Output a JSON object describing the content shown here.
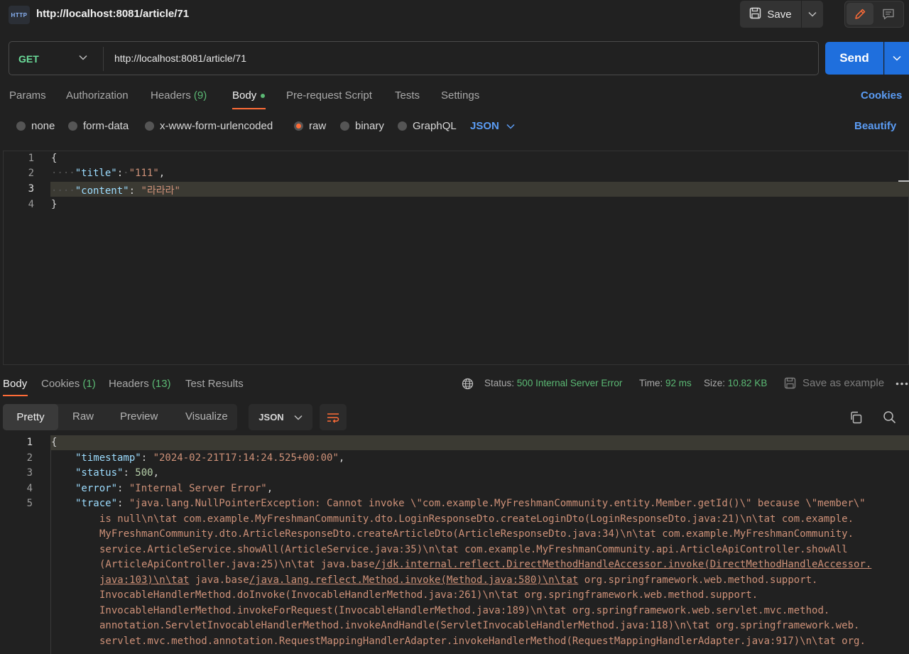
{
  "header": {
    "icon_text": "HTTP",
    "title": "http://localhost:8081/article/71",
    "save_label": "Save"
  },
  "request": {
    "method": "GET",
    "url": "http://localhost:8081/article/71",
    "send_label": "Send",
    "tabs": {
      "params": "Params",
      "authorization": "Authorization",
      "headers": "Headers",
      "headers_count": "(9)",
      "body": "Body",
      "prerequest": "Pre-request Script",
      "tests": "Tests",
      "settings": "Settings"
    },
    "cookies_label": "Cookies",
    "body_types": [
      "none",
      "form-data",
      "x-www-form-urlencoded",
      "raw",
      "binary",
      "GraphQL"
    ],
    "selected_body_type": "raw",
    "format": "JSON",
    "beautify_label": "Beautify",
    "editor": {
      "line_numbers": [
        "1",
        "2",
        "3",
        "4"
      ],
      "l1": "{",
      "l2_dots": "····",
      "l2_key": "\"title\"",
      "l2_colon": ":",
      "l2_dot2": "·",
      "l2_val": "\"111\"",
      "l2_comma": ",",
      "l3_dots": "····",
      "l3_key": "\"content\"",
      "l3_colon": ": ",
      "l3_val": "\"라라라\"",
      "l4": "}"
    }
  },
  "response": {
    "tabs": {
      "body": "Body",
      "cookies": "Cookies",
      "cookies_count": "(1)",
      "headers": "Headers",
      "headers_count": "(13)",
      "test_results": "Test Results"
    },
    "status_label": "Status:",
    "status_value": "500 Internal Server Error",
    "time_label": "Time:",
    "time_value": "92 ms",
    "size_label": "Size:",
    "size_value": "10.82 KB",
    "save_example_label": "Save as example",
    "views": [
      "Pretty",
      "Raw",
      "Preview",
      "Visualize"
    ],
    "format": "JSON",
    "body_lines": {
      "numbers": [
        "1",
        "2",
        "3",
        "4",
        "5"
      ],
      "l1": "{",
      "l2_key": "\"timestamp\"",
      "l2_val": "\"2024-02-21T17:14:24.525+00:00\"",
      "l3_key": "\"status\"",
      "l3_val": "500",
      "l4_key": "\"error\"",
      "l4_val": "\"Internal Server Error\"",
      "l5_key": "\"trace\"",
      "l5_val": "\"java.lang.NullPointerException: Cannot invoke \\\"com.example.MyFreshmanCommunity.entity.Member.getId()\\\" because \\\"member\\\"",
      "w1": "is null\\n\\tat com.example.MyFreshmanCommunity.dto.LoginResponseDto.createLoginDto(LoginResponseDto.java:21)\\n\\tat com.example.",
      "w2": "MyFreshmanCommunity.dto.ArticleResponseDto.createArticleDto(ArticleResponseDto.java:34)\\n\\tat com.example.MyFreshmanCommunity.",
      "w3": "service.ArticleService.showAll(ArticleService.java:35)\\n\\tat com.example.MyFreshmanCommunity.api.ArticleApiController.showAll",
      "w4a": "(ArticleApiController.java:25)\\n\\tat java.base",
      "w4b": "/jdk.internal.reflect.DirectMethodHandleAccessor.invoke(DirectMethodHandleAccessor.",
      "w5a": "java:103)\\n\\tat",
      "w5b": " java.base",
      "w5c": "/java.lang.reflect.Method.invoke(Method.java:580)\\n\\tat",
      "w5d": " org.springframework.web.method.support.",
      "w6": "InvocableHandlerMethod.doInvoke(InvocableHandlerMethod.java:261)\\n\\tat org.springframework.web.method.support.",
      "w7": "InvocableHandlerMethod.invokeForRequest(InvocableHandlerMethod.java:189)\\n\\tat org.springframework.web.servlet.mvc.method.",
      "w8": "annotation.ServletInvocableHandlerMethod.invokeAndHandle(ServletInvocableHandlerMethod.java:118)\\n\\tat org.springframework.web.",
      "w9": "servlet.mvc.method.annotation.RequestMappingHandlerAdapter.invokeHandlerMethod(RequestMappingHandlerAdapter.java:917)\\n\\tat org."
    }
  },
  "colors": {
    "accent_orange": "#ff6c37",
    "send_blue": "#1f6fdd",
    "link_blue": "#5b9cf4",
    "success_green": "#5bb974",
    "method_green": "#6bdd9a"
  },
  "icons": [
    "http-icon",
    "save-icon",
    "chevron-down-icon",
    "pencil-icon",
    "comment-icon",
    "globe-icon",
    "save-example-icon",
    "more-icon",
    "wrap-lines-icon",
    "copy-icon",
    "search-icon"
  ]
}
